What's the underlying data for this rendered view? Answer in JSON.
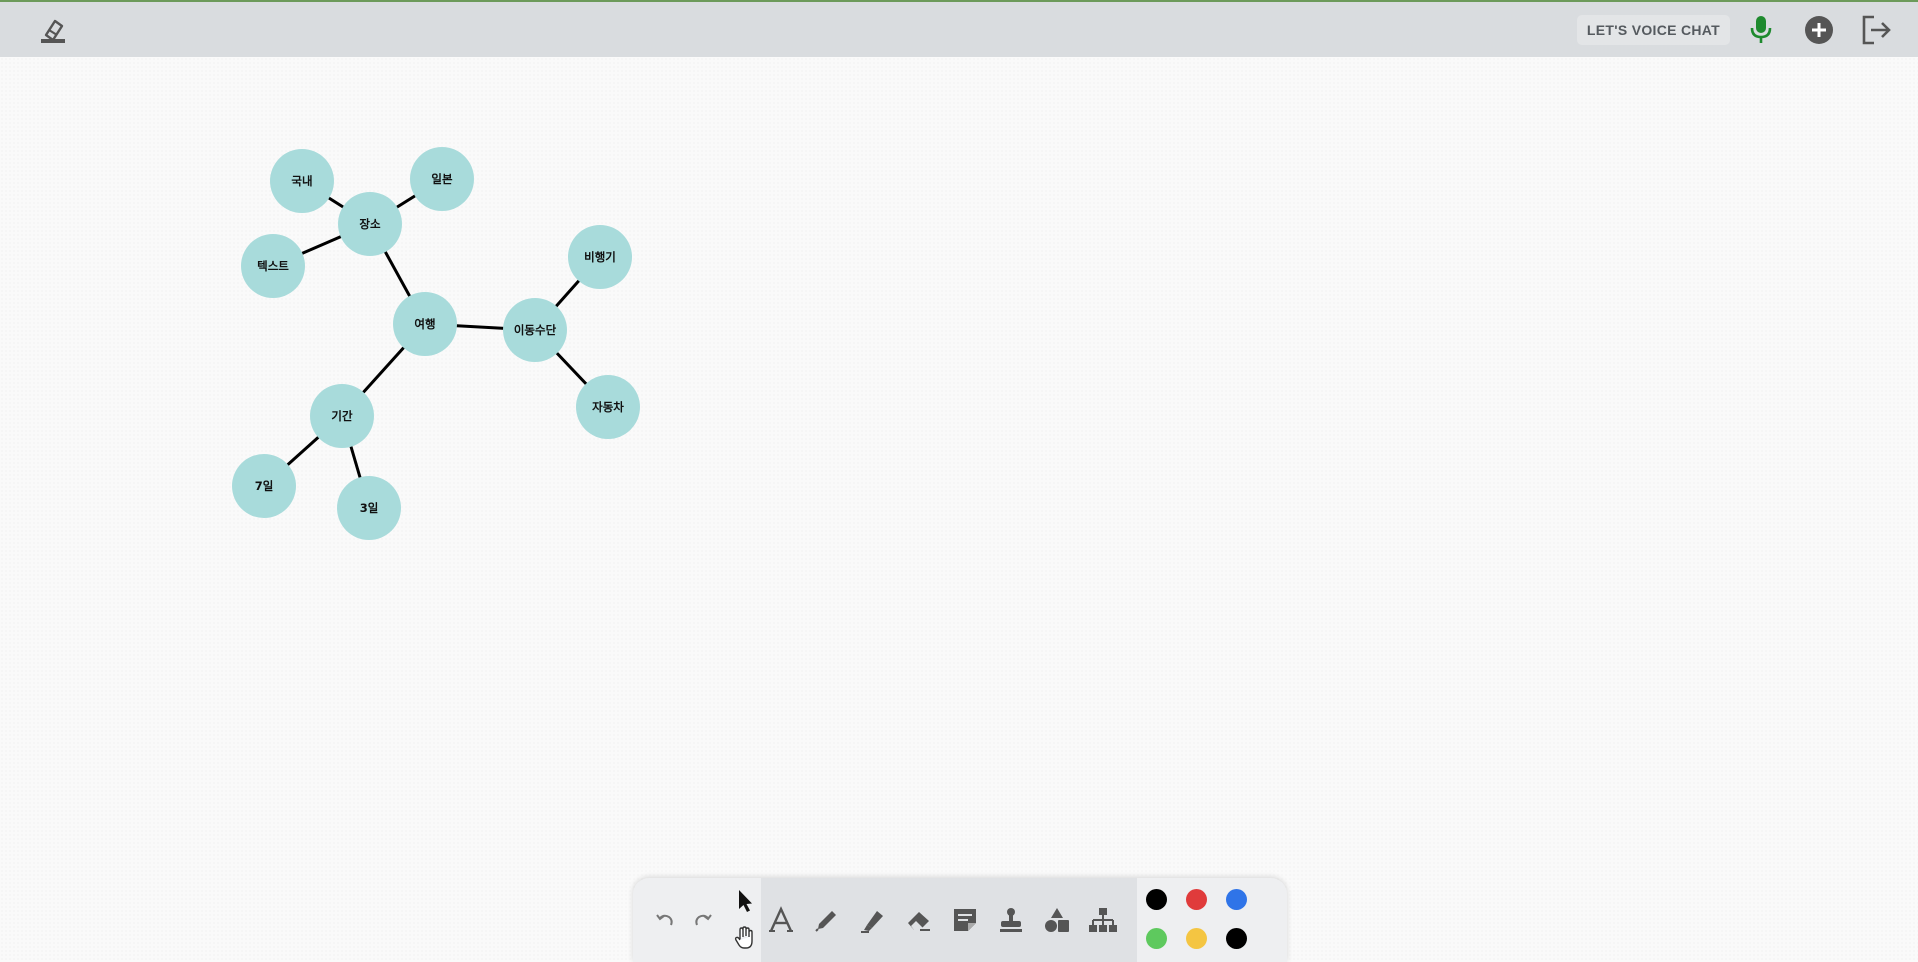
{
  "header": {
    "voice_chat_label": "LET'S VOICE CHAT",
    "icons": [
      "whiteboard-logo-icon",
      "microphone-icon",
      "add-circle-icon",
      "logout-icon"
    ],
    "mic_color": "#1e8a2e"
  },
  "mindmap": {
    "node_color": "#a8dbdb",
    "edge_color": "#000000",
    "nodes": [
      {
        "id": "travel",
        "label": "여행"
      },
      {
        "id": "place",
        "label": "장소"
      },
      {
        "id": "domestic",
        "label": "국내"
      },
      {
        "id": "japan",
        "label": "일본"
      },
      {
        "id": "text",
        "label": "텍스트"
      },
      {
        "id": "transport",
        "label": "이동수단"
      },
      {
        "id": "airplane",
        "label": "비행기"
      },
      {
        "id": "car",
        "label": "자동차"
      },
      {
        "id": "period",
        "label": "기간"
      },
      {
        "id": "seven_days",
        "label": "7일"
      },
      {
        "id": "three_days",
        "label": "3일"
      }
    ],
    "edges": [
      [
        "travel",
        "place"
      ],
      [
        "place",
        "domestic"
      ],
      [
        "place",
        "japan"
      ],
      [
        "place",
        "text"
      ],
      [
        "travel",
        "transport"
      ],
      [
        "transport",
        "airplane"
      ],
      [
        "transport",
        "car"
      ],
      [
        "travel",
        "period"
      ],
      [
        "period",
        "seven_days"
      ],
      [
        "period",
        "three_days"
      ]
    ]
  },
  "toolbar": {
    "history": [
      "undo-icon",
      "redo-icon"
    ],
    "modes": [
      "select-pointer-icon",
      "pan-hand-icon"
    ],
    "tools": [
      "text-tool-icon",
      "pen-tool-icon",
      "highlighter-tool-icon",
      "eraser-tool-icon",
      "sticky-note-tool-icon",
      "stamp-tool-icon",
      "shapes-tool-icon",
      "mindmap-tool-icon"
    ],
    "colors": [
      "#000000",
      "#e03b3b",
      "#2f74e8",
      "#5ec95e",
      "#f4c542",
      "#000000"
    ]
  }
}
